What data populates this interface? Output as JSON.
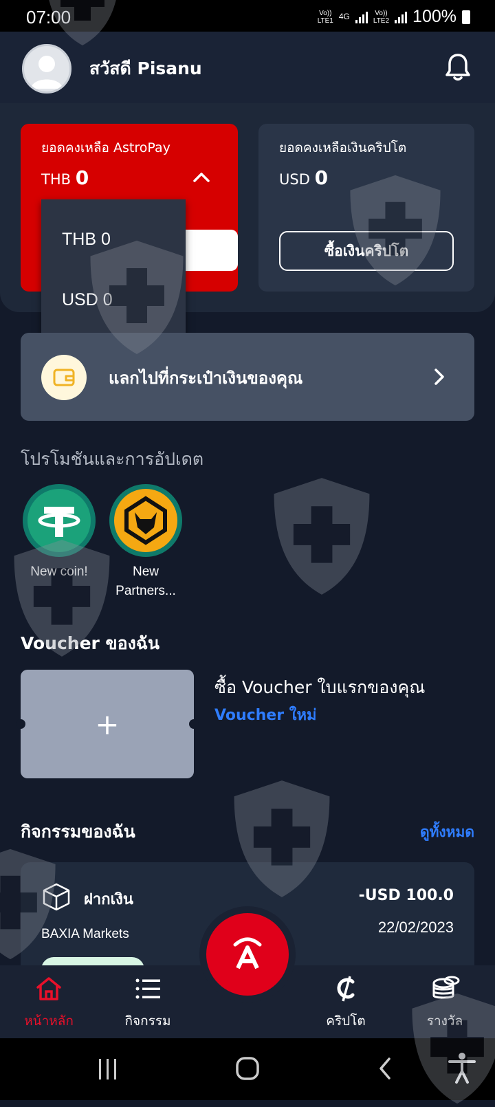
{
  "status_bar": {
    "time": "07:00",
    "sim1": "Vo)) LTE1",
    "sim1_net": "4G",
    "sim2": "Vo)) LTE2",
    "battery": "100%"
  },
  "header": {
    "greeting": "สวัสดี Pisanu",
    "avatar_icon": "user-avatar-icon",
    "bell_icon": "bell-icon"
  },
  "astropay_card": {
    "label": "ยอดคงเหลือ AstroPay",
    "currency": "THB",
    "amount": "0",
    "color": "#d60000"
  },
  "currency_dropdown": {
    "options": [
      "THB 0",
      "USD 0"
    ]
  },
  "crypto_card": {
    "label": "ยอดคงเหลือเงินคริปโต",
    "currency": "USD",
    "amount": "0",
    "button": "ซื้อเงินคริปโต"
  },
  "wallet_transfer": {
    "label": "แลกไปที่กระเป๋าเงินของคุณ",
    "icon": "wallet-icon"
  },
  "promotions": {
    "title": "โปรโมชันและการอัปเดต",
    "items": [
      {
        "label": "New coin!",
        "icon": "tether-icon"
      },
      {
        "label": "New Partners...",
        "icon": "wolves-icon"
      }
    ]
  },
  "vouchers": {
    "title": "Voucher ของฉัน",
    "empty_title": "ซื้อ Voucher ใบแรกของคุณ",
    "new_link": "Voucher ใหม่",
    "add_symbol": "+"
  },
  "activity": {
    "title": "กิจกรรมของฉัน",
    "see_all": "ดูทั้งหมด",
    "items": [
      {
        "type": "ฝากเงิน",
        "merchant": "BAXIA Markets",
        "amount": "-USD 100.0",
        "date": "22/02/2023"
      }
    ]
  },
  "bottom_nav": {
    "items": [
      {
        "label": "หน้าหลัก",
        "icon": "home-icon",
        "active": true
      },
      {
        "label": "กิจกรรม",
        "icon": "list-icon",
        "active": false
      },
      {
        "label": "คริปโต",
        "icon": "crypto-icon",
        "active": false
      },
      {
        "label": "รางวัล",
        "icon": "coins-icon",
        "active": false
      }
    ],
    "center_button_icon": "astropay-logo-icon"
  },
  "colors": {
    "background": "#131a2a",
    "accent_red": "#e0001a",
    "link_blue": "#2f7dff"
  }
}
